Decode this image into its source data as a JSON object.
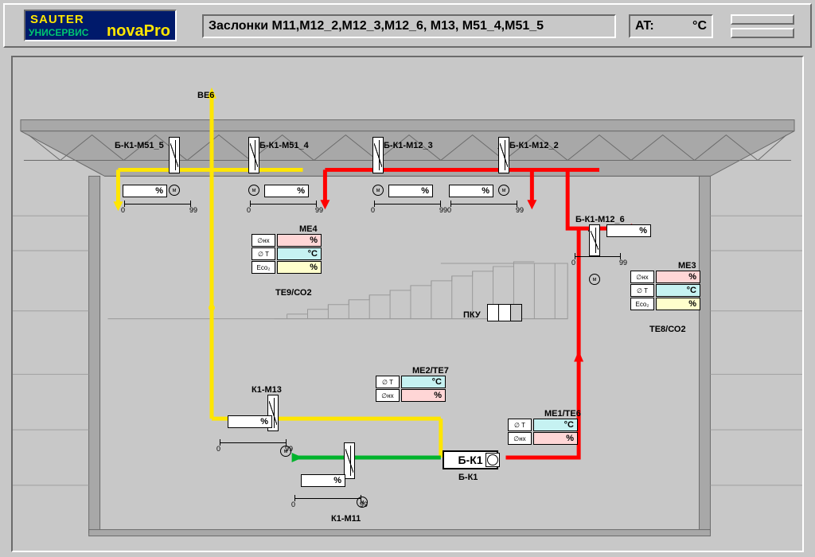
{
  "header": {
    "logo_line1": "SAUTER",
    "logo_line2": "УНИСЕРВИС",
    "logo_line3": "novaPro",
    "title": "Заслонки М11,М12_2,М12_3,М12_6, М13, М51_4,М51_5",
    "at_label": "AT:",
    "at_unit": "°C"
  },
  "labels": {
    "BE6": "ВЕ6",
    "m51_5": "Б-К1-М51_5",
    "m51_4": "Б-К1-М51_4",
    "m12_3": "Б-К1-М12_3",
    "m12_2": "Б-К1-М12_2",
    "m12_6": "Б-К1-М12_6",
    "k1m13": "К1-М13",
    "k1m11": "К1-М11",
    "me4": "МЕ4",
    "me3": "МЕ3",
    "me2": "МЕ2/ТЕ7",
    "me1": "МЕ1/ТЕ6",
    "te9": "ТЕ9/СО2",
    "te8": "ТЕ8/СО2",
    "bk1": "Б-К1",
    "bk1_lbl": "Б-К1",
    "pku": "ПКУ",
    "sc0": "0",
    "sc99": "99",
    "pct": "%",
    "degC": "°C"
  },
  "tags": {
    "hx": "∅нх",
    "t": "∅ T",
    "eco2": "Eco₂"
  }
}
